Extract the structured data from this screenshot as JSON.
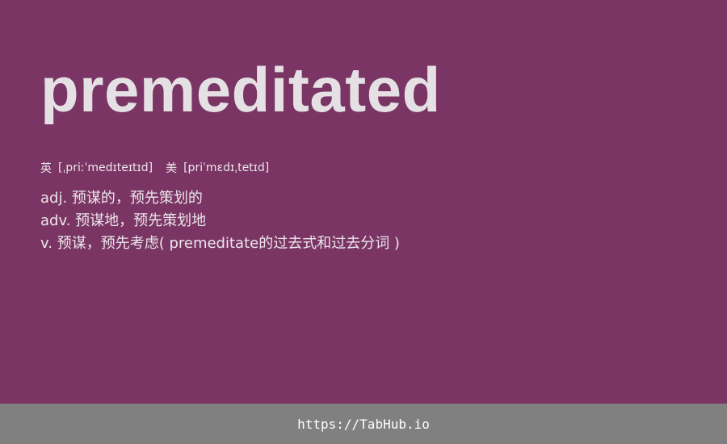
{
  "entry": {
    "word": "premeditated",
    "phonetics": [
      {
        "region": "英",
        "ipa": "[ˌpriːˈmedɪteɪtɪd]"
      },
      {
        "region": "美",
        "ipa": "[priˈmɛdɪˌtetɪd]"
      }
    ],
    "definitions": [
      "adj. 预谋的，预先策划的",
      "adv. 预谋地，预先策划地",
      "v. 预谋，预先考虑( premeditate的过去式和过去分词 )"
    ]
  },
  "footer": {
    "link_text": "https://TabHub.io"
  },
  "colors": {
    "background": "#7a3565",
    "footer_background": "#808080",
    "text": "#ece6ea"
  }
}
